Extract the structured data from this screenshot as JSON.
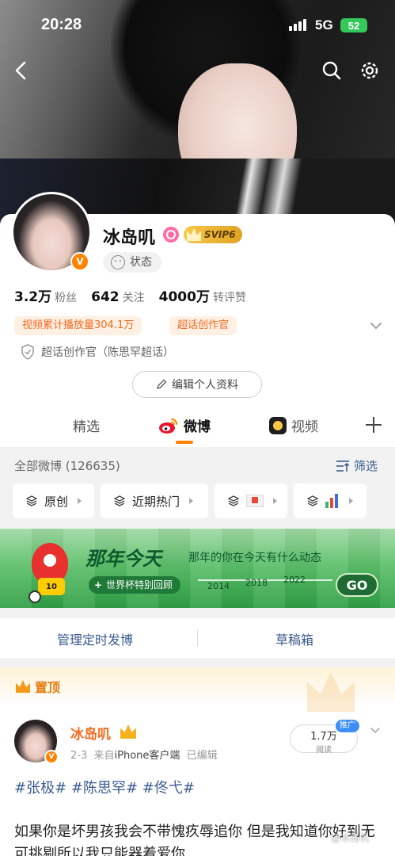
{
  "status_bar": {
    "time": "20:28",
    "network": "5G",
    "battery": "52"
  },
  "profile": {
    "name": "冰岛叽",
    "avatar_badge": "V",
    "svip_badge": "SVIP6",
    "status": "状态",
    "stats": [
      {
        "num": "3.2万",
        "label": "粉丝"
      },
      {
        "num": "642",
        "label": "关注"
      },
      {
        "num": "4000万",
        "label": "转评赞"
      }
    ],
    "tags": [
      "视频累计播放量304.1万",
      "超话创作官"
    ],
    "super_topic": "超话创作官（陈思罕超话）",
    "edit_button": "编辑个人资料"
  },
  "tabs": {
    "featured": "精选",
    "weibo": "微博",
    "video": "视频"
  },
  "filter": {
    "heading": "全部微博 (126635)",
    "filter_button": "筛选",
    "chips": [
      "原创",
      "近期热门"
    ]
  },
  "banner": {
    "title": "那年今天",
    "subtitle": "那年的你在今天有什么动态",
    "pill": "世界杯特别回顾",
    "mascot_number": "10",
    "years": [
      "2014",
      "2018",
      "2022"
    ],
    "go": "GO"
  },
  "manage": {
    "scheduled": "管理定时发博",
    "drafts": "草稿箱"
  },
  "post": {
    "pinned_label": "置顶",
    "author": "冰岛叽",
    "avatar_badge": "V",
    "date": "2-3",
    "source_prefix": "来自",
    "source": "iPhone客户端",
    "edited": "已编辑",
    "reads": "1.7万",
    "reads_label": "阅读",
    "promo": "推广",
    "hashtags": "#张极# #陈思罕# #佟弋#",
    "text": "如果你是坏男孩我会不带愧疚辱追你 但是我知道你好到无可挑剔所以我只能器着爱你"
  },
  "watermark": "@冰岛叽",
  "colors": {
    "accent": "#ff8200",
    "link": "#3b5b8f",
    "tag_text": "#f46a1d"
  }
}
